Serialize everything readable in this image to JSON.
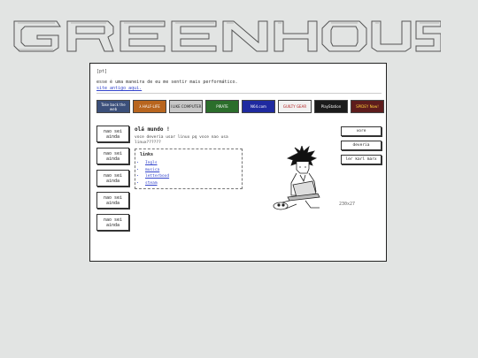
{
  "header": {
    "logo_text": "GREENHOUSE"
  },
  "page": {
    "tag": "[pt]",
    "intro_line": "esse é uma maneira de eu me sentir mais performático.",
    "old_site_link": "site antigo aqui."
  },
  "buttons88x31": [
    {
      "label": "Take back the web",
      "bg": "#3b4f7a",
      "fg": "#ffffff"
    },
    {
      "label": "λ HALF-LIFE",
      "bg": "#b8651e",
      "fg": "#ffffff"
    },
    {
      "label": "I LIKE COMPUTER",
      "bg": "#c8c8c8",
      "fg": "#222222"
    },
    {
      "label": "PIRATE",
      "bg": "#2b6e2b",
      "fg": "#ffffff"
    },
    {
      "label": "N64.com",
      "bg": "#1f2aa0",
      "fg": "#ffffff"
    },
    {
      "label": "GUILTY GEAR",
      "bg": "#f2f2f2",
      "fg": "#b01c1c"
    },
    {
      "label": "PlayStation",
      "bg": "#1b1b1b",
      "fg": "#ffffff"
    },
    {
      "label": "SPIDEY Now!",
      "bg": "#5e1c1c",
      "fg": "#ffd23c"
    }
  ],
  "sidebar": {
    "items": [
      {
        "label": "nao sei ainda"
      },
      {
        "label": "nao sei ainda"
      },
      {
        "label": "nao sei ainda"
      },
      {
        "label": "nao sei ainda"
      },
      {
        "label": "nao sei ainda"
      }
    ]
  },
  "main": {
    "title": "olá mundo !",
    "text": "voce deveria usar linux pq voce nao usa linux??????",
    "links_title": "links",
    "links": [
      "Ingls",
      "musica",
      "letterboxd",
      "steam"
    ],
    "image_caption": "230x27"
  },
  "right_buttons": [
    "vore",
    "deveria",
    "ler karl marx"
  ]
}
